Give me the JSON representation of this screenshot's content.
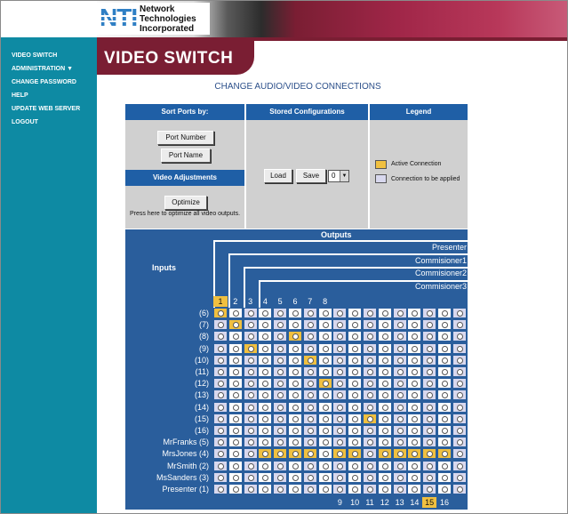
{
  "header": {
    "logo_mark": "NTI",
    "logo_lines": [
      "Network",
      "Technologies",
      "Incorporated"
    ]
  },
  "sidebar": {
    "items": [
      {
        "label": "VIDEO SWITCH"
      },
      {
        "label": "ADMINISTRATION ▼"
      },
      {
        "label": "CHANGE PASSWORD"
      },
      {
        "label": "HELP"
      },
      {
        "label": "UPDATE WEB SERVER"
      },
      {
        "label": "LOGOUT"
      }
    ]
  },
  "page": {
    "title": "VIDEO SWITCH",
    "subtitle": "CHANGE AUDIO/VIDEO CONNECTIONS"
  },
  "sort_panel": {
    "heading": "Sort Ports by:",
    "port_number_label": "Port Number",
    "port_name_label": "Port Name"
  },
  "video_adjust": {
    "heading": "Video Adjustments",
    "optimize_label": "Optimize",
    "note": "Press here to optimize all video outputs."
  },
  "stored_panel": {
    "heading": "Stored Configurations",
    "load_label": "Load",
    "save_label": "Save",
    "selected_config": "0"
  },
  "legend": {
    "heading": "Legend",
    "active_label": "Active Connection",
    "pending_label": "Connection to be applied",
    "active_color": "#f0c040",
    "pending_color": "#d8d8ee"
  },
  "matrix": {
    "outputs_label": "Outputs",
    "inputs_label": "Inputs",
    "output_names": [
      "Presenter",
      "Commisioner1",
      "Commisioner2",
      "Commisioner3"
    ],
    "top_columns": [
      "1",
      "2",
      "3",
      "4",
      "5",
      "6",
      "7",
      "8"
    ],
    "bottom_columns": [
      "9",
      "10",
      "11",
      "12",
      "13",
      "14",
      "15",
      "16"
    ],
    "highlighted_top_column": "1",
    "highlighted_bottom_column": "15",
    "rows": [
      {
        "label": "(6)",
        "active_col": 1
      },
      {
        "label": "(7)",
        "active_col": 2
      },
      {
        "label": "(8)",
        "active_col": 6
      },
      {
        "label": "(9)",
        "active_col": 3
      },
      {
        "label": "(10)",
        "active_col": 7
      },
      {
        "label": "(11)",
        "active_col": 0
      },
      {
        "label": "(12)",
        "active_col": 8
      },
      {
        "label": "(13)",
        "active_col": 0
      },
      {
        "label": "(14)",
        "active_col": 0
      },
      {
        "label": "(15)",
        "active_col": 11
      },
      {
        "label": "(16)",
        "active_col": 0
      },
      {
        "label": "MrFranks (5)",
        "active_col": 0
      },
      {
        "label": "MrsJones (4)",
        "active_cols": [
          4,
          5,
          6,
          7,
          9,
          10,
          12,
          13,
          14,
          15,
          16
        ]
      },
      {
        "label": "MrSmith (2)",
        "active_col": 0
      },
      {
        "label": "MsSanders (3)",
        "active_col": 0
      },
      {
        "label": "Presenter (1)",
        "active_col": 0
      }
    ],
    "column_count": 17
  }
}
